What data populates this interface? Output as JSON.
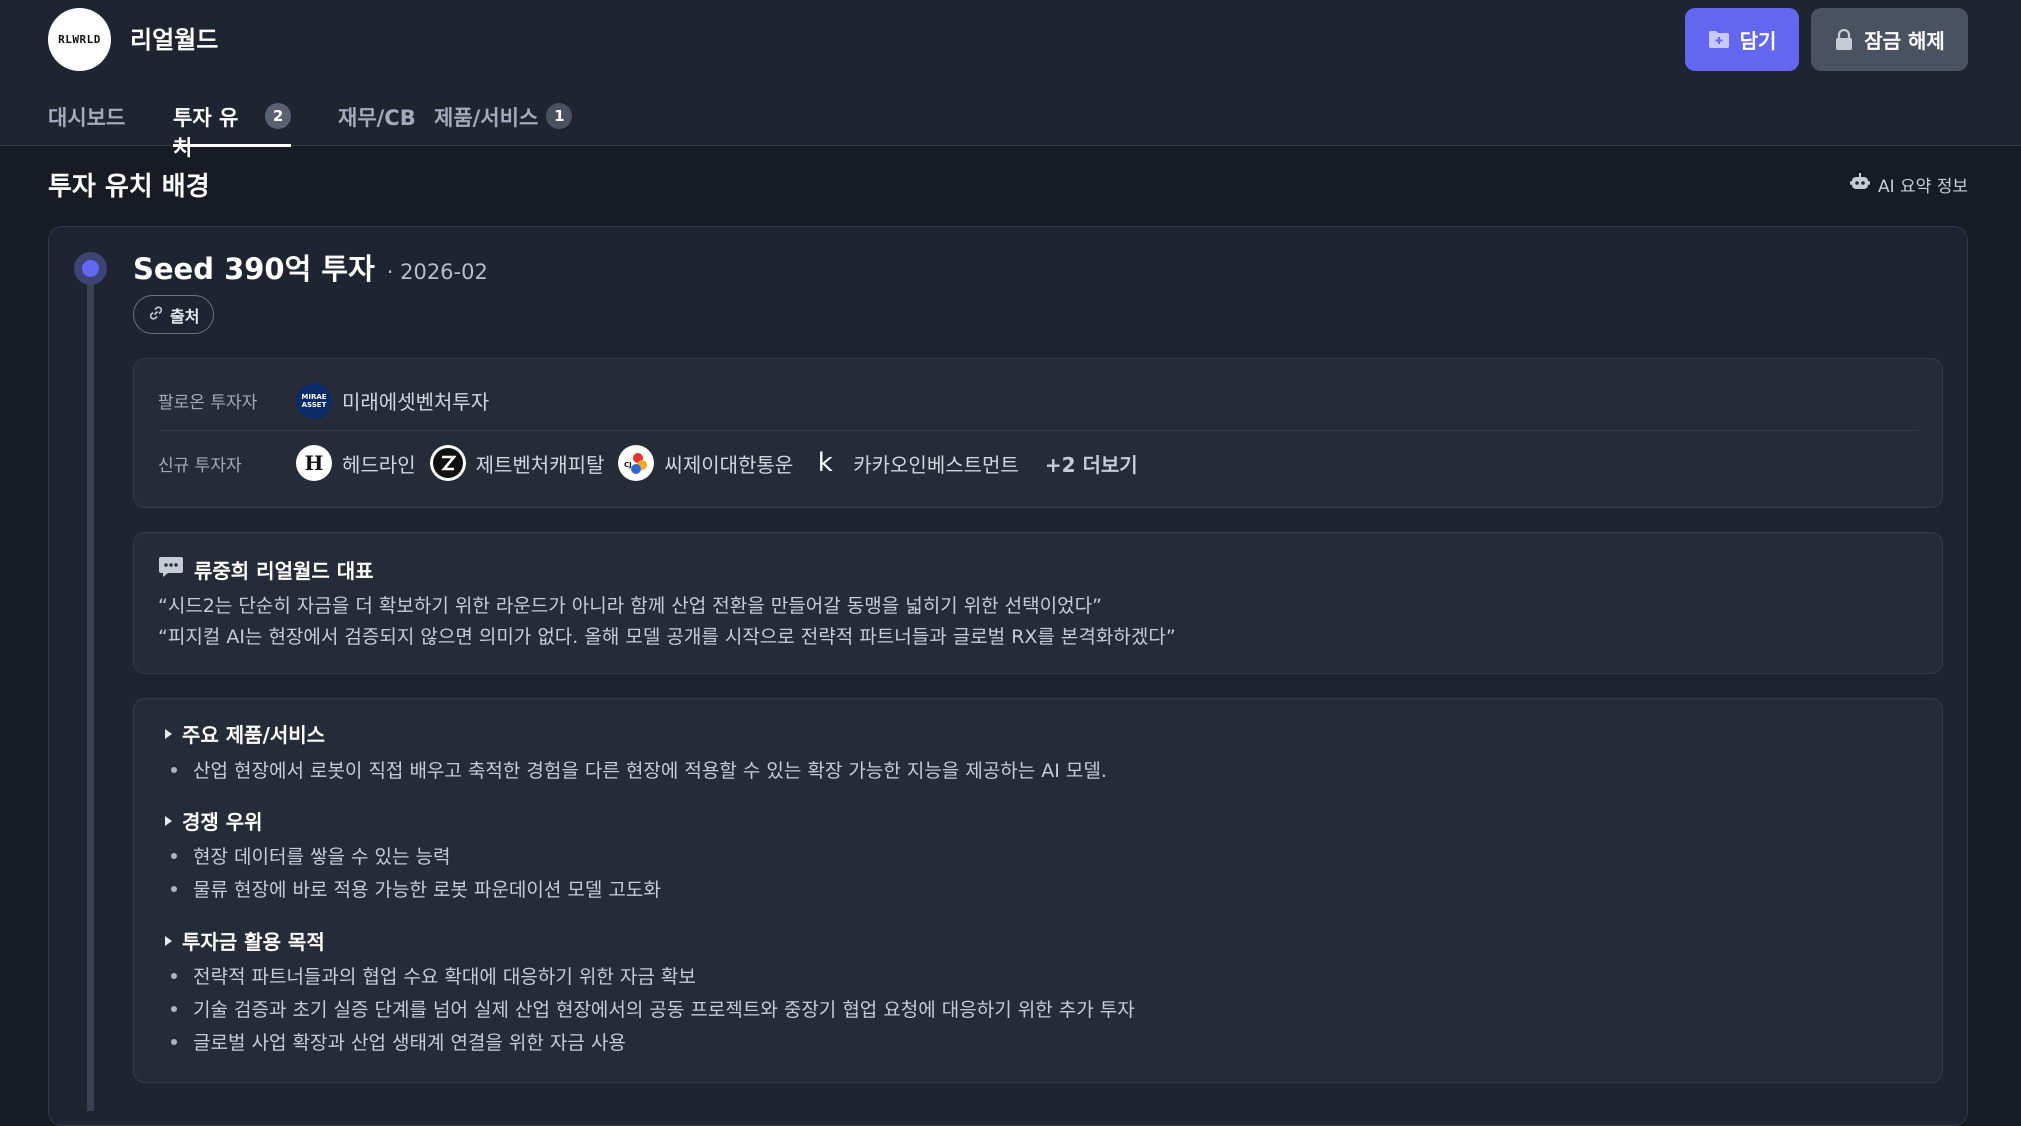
{
  "header": {
    "logo_text": "RLWRLD",
    "company_name": "리얼월드",
    "save_button": "담기",
    "unlock_button": "잠금 해제"
  },
  "tabs": [
    {
      "label": "대시보드",
      "badge": ""
    },
    {
      "label": "투자 유치",
      "badge": "2",
      "active": true
    },
    {
      "label": "재무/CB",
      "badge": ""
    },
    {
      "label": "제품/서비스",
      "badge": "1"
    }
  ],
  "section": {
    "title": "투자 유치 배경",
    "ai_info": "AI 요약 정보"
  },
  "round": {
    "name": "Seed 390억 투자",
    "date": "· 2026-02",
    "source_label": "출처",
    "follow_on_label": "팔로온 투자자",
    "new_label": "신규 투자자",
    "follow_on_investors": [
      {
        "name": "미래에셋벤처투자",
        "logo": "MIRAE ASSET"
      }
    ],
    "new_investors": [
      {
        "name": "헤드라인",
        "logo": "H"
      },
      {
        "name": "제트벤처캐피탈",
        "logo": "Z"
      },
      {
        "name": "씨제이대한통운",
        "logo": "CJ"
      },
      {
        "name": "카카오인베스트먼트",
        "logo": "k"
      }
    ],
    "more_label": "+2 더보기"
  },
  "quote": {
    "speaker": "류중희 리얼월드 대표",
    "lines": [
      "“시드2는 단순히 자금을 더 확보하기 위한 라운드가 아니라 함께 산업 전환을 만들어갈 동맹을 넓히기 위한 선택이었다”",
      "“피지컬 AI는 현장에서 검증되지 않으면 의미가 없다. 올해 모델 공개를 시작으로 전략적 파트너들과 글로벌 RX를 본격화하겠다”"
    ]
  },
  "details": {
    "sections": [
      {
        "heading": "주요 제품/서비스",
        "items": [
          "산업 현장에서 로봇이 직접 배우고 축적한 경험을 다른 현장에 적용할 수 있는 확장 가능한 지능을 제공하는 AI 모델."
        ]
      },
      {
        "heading": "경쟁 우위",
        "items": [
          "현장 데이터를 쌓을 수 있는 능력",
          "물류 현장에 바로 적용 가능한 로봇 파운데이션 모델 고도화"
        ]
      },
      {
        "heading": "투자금 활용 목적",
        "items": [
          "전략적 파트너들과의 협업 수요 확대에 대응하기 위한 자금 확보",
          "기술 검증과 초기 실증 단계를 넘어 실제 산업 현장에서의 공동 프로젝트와 중장기 협업 요청에 대응하기 위한 추가 투자",
          "글로벌 사업 확장과 산업 생태계 연결을 위한 자금 사용"
        ]
      }
    ]
  },
  "colors": {
    "accent": "#6366f1",
    "background": "#161b24",
    "surface": "#1e2430",
    "panel": "#252c38"
  }
}
